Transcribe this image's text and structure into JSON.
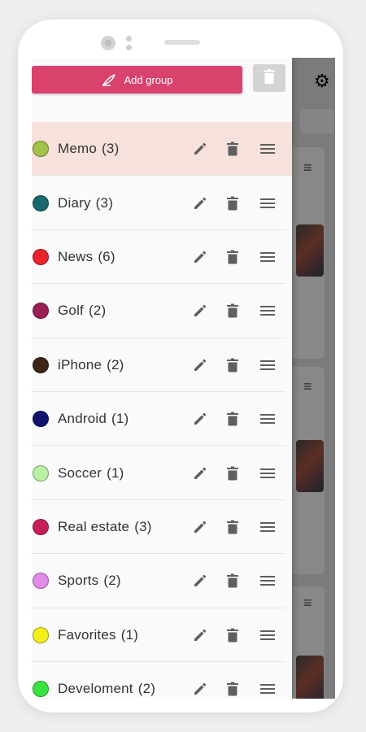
{
  "toolbar": {
    "add_group_label": "Add group",
    "accent_color": "#d8426d"
  },
  "groups": [
    {
      "name": "Memo",
      "count": "(3)",
      "color": "#a3c24a",
      "selected": true
    },
    {
      "name": "Diary",
      "count": "(3)",
      "color": "#17696c"
    },
    {
      "name": "News",
      "count": "(6)",
      "color": "#e8232a"
    },
    {
      "name": "Golf",
      "count": "(2)",
      "color": "#9b1d55"
    },
    {
      "name": "iPhone",
      "count": "(2)",
      "color": "#3d2616"
    },
    {
      "name": "Android",
      "count": "(1)",
      "color": "#10126f"
    },
    {
      "name": "Soccer",
      "count": "(1)",
      "color": "#b8f0a4"
    },
    {
      "name": "Real estate",
      "count": "(3)",
      "color": "#c81e57"
    },
    {
      "name": "Sports",
      "count": "(2)",
      "color": "#e18be7"
    },
    {
      "name": "Favorites",
      "count": "(1)",
      "color": "#f3ef18"
    },
    {
      "name": "Develoment",
      "count": "(2)",
      "color": "#3ae43e"
    }
  ],
  "row_icons": {
    "edit": "pencil-icon",
    "delete": "trash-icon",
    "reorder": "drag-handle-icon"
  }
}
